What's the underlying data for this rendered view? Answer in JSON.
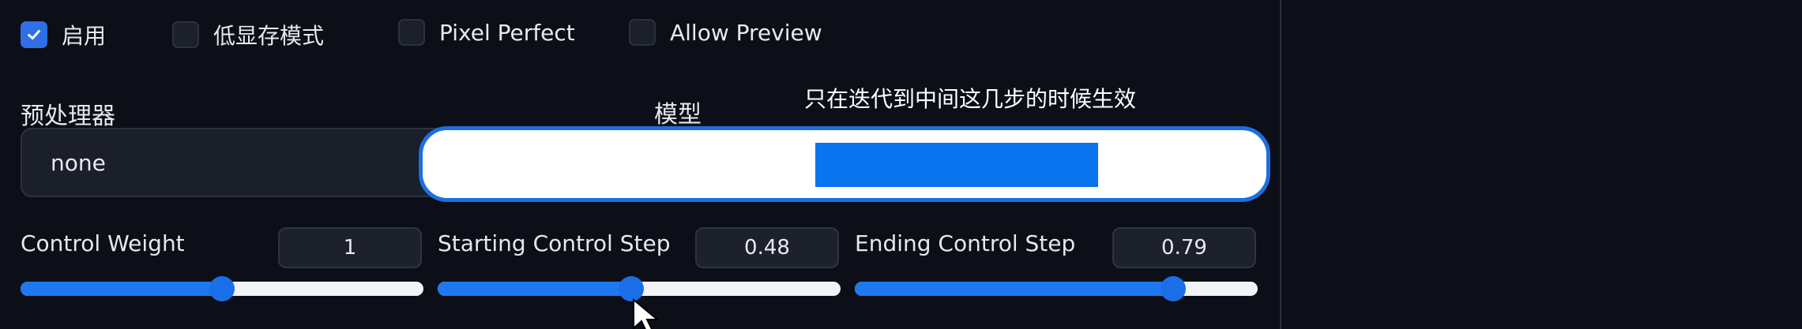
{
  "checkboxes": [
    {
      "label": "启用",
      "checked": true
    },
    {
      "label": "低显存模式",
      "checked": false
    },
    {
      "label": "Pixel Perfect",
      "checked": false
    },
    {
      "label": "Allow Preview",
      "checked": false
    }
  ],
  "preprocessor": {
    "label": "预处理器",
    "value": "none"
  },
  "model": {
    "label": "模型"
  },
  "caption": "只在迭代到中间这几步的时候生效",
  "sliders": [
    {
      "label": "Control Weight",
      "value": "1",
      "fraction": 0.5
    },
    {
      "label": "Starting Control Step",
      "value": "0.48",
      "fraction": 0.48
    },
    {
      "label": "Ending Control Step",
      "value": "0.79",
      "fraction": 0.79
    }
  ],
  "colors": {
    "accent": "#1e78f0",
    "background": "#0c0f17",
    "overlay_border": "#1c6fe0"
  }
}
